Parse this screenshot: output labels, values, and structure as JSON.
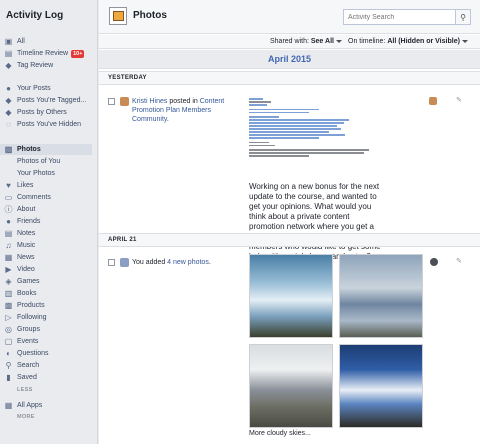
{
  "sidebar": {
    "title": "Activity Log",
    "items": [
      {
        "label": "All",
        "icon": "all-icon"
      },
      {
        "label": "Timeline Review",
        "icon": "timeline-review-icon",
        "badge": "10+"
      },
      {
        "label": "Tag Review",
        "icon": "tag-icon"
      },
      {
        "label": "Your Posts",
        "icon": "person-icon"
      },
      {
        "label": "Posts You're Tagged...",
        "icon": "tag-icon"
      },
      {
        "label": "Posts by Others",
        "icon": "tag-icon"
      },
      {
        "label": "Posts You've Hidden",
        "icon": "hidden-icon"
      },
      {
        "label": "Photos",
        "icon": "photos-icon",
        "active": true
      },
      {
        "label": "Photos of You",
        "sub": true
      },
      {
        "label": "Your Photos",
        "sub": true
      },
      {
        "label": "Likes",
        "icon": "like-icon"
      },
      {
        "label": "Comments",
        "icon": "comment-icon"
      },
      {
        "label": "About",
        "icon": "info-icon"
      },
      {
        "label": "Friends",
        "icon": "friends-icon"
      },
      {
        "label": "Notes",
        "icon": "notes-icon"
      },
      {
        "label": "Music",
        "icon": "music-icon"
      },
      {
        "label": "News",
        "icon": "news-icon"
      },
      {
        "label": "Video",
        "icon": "video-icon"
      },
      {
        "label": "Games",
        "icon": "games-icon"
      },
      {
        "label": "Books",
        "icon": "books-icon"
      },
      {
        "label": "Products",
        "icon": "products-icon"
      },
      {
        "label": "Following",
        "icon": "following-icon"
      },
      {
        "label": "Groups",
        "icon": "groups-icon"
      },
      {
        "label": "Events",
        "icon": "events-icon"
      },
      {
        "label": "Questions",
        "icon": "questions-icon"
      },
      {
        "label": "Search",
        "icon": "search-icon"
      },
      {
        "label": "Saved",
        "icon": "saved-icon"
      }
    ],
    "less_label": "LESS",
    "all_apps": "All Apps",
    "more_label": "MORE"
  },
  "header": {
    "title": "Photos",
    "search_placeholder": "Activity Search"
  },
  "filters": {
    "shared_with_label": "Shared with:",
    "shared_with_value": "See All",
    "on_timeline_label": "On timeline:",
    "on_timeline_value": "All (Hidden or Visible)"
  },
  "month": "April 2015",
  "sections": {
    "yesterday": "YESTERDAY",
    "april21": "APRIL 21"
  },
  "entry1": {
    "user": "Kristi Hines",
    "verb": " posted in ",
    "group": "Content Promotion Plan Members Community",
    "body": "Working on a new bonus for the next update to the course, and wanted to get your opinions. What would you think about a private content promotion network where you get a daily digest of emails like this from members who would like to get some help with social shares and votes?"
  },
  "entry2": {
    "prefix": "You added ",
    "link": "4 new photos",
    "suffix": ".",
    "caption": "More cloudy skies..."
  },
  "colors": {
    "link": "#365899",
    "month": "#4267b2",
    "badge": "#e53935"
  }
}
